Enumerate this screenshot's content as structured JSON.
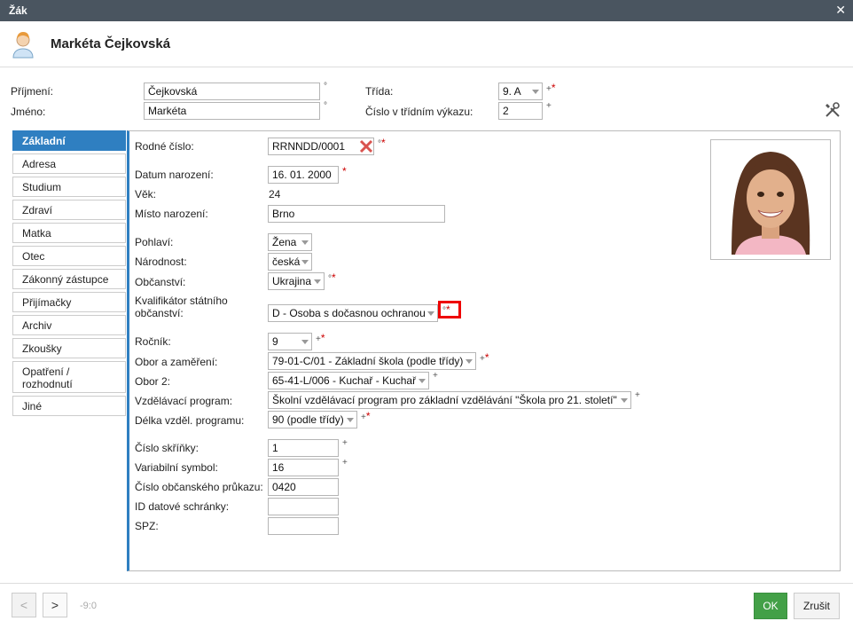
{
  "window": {
    "title": "Žák",
    "close_glyph": "✕"
  },
  "person": {
    "name": "Markéta Čejkovská",
    "avatar_icon": "user-avatar-icon"
  },
  "top": {
    "prijmeni_label": "Příjmení:",
    "prijmeni_value": "Čejkovská",
    "jmeno_label": "Jméno:",
    "jmeno_value": "Markéta",
    "trida_label": "Třída:",
    "trida_value": "9. A",
    "cislo_label": "Číslo v třídním výkazu:",
    "cislo_value": "2",
    "marks": {
      "degree": "°",
      "plus": "+",
      "req": "*"
    }
  },
  "tabs": [
    "Základní",
    "Adresa",
    "Studium",
    "Zdraví",
    "Matka",
    "Otec",
    "Zákonný zástupce",
    "Přijímačky",
    "Archiv",
    "Zkoušky",
    "Opatření / rozhodnutí",
    "Jiné"
  ],
  "active_tab": "Základní",
  "form": {
    "rodne_cislo_label": "Rodné číslo:",
    "rodne_cislo_value": "RRNNDD/0001",
    "datum_label": "Datum narození:",
    "datum_value": "16. 01. 2000",
    "vek_label": "Věk:",
    "vek_value": "24",
    "misto_label": "Místo narození:",
    "misto_value": "Brno",
    "pohlavi_label": "Pohlaví:",
    "pohlavi_value": "Žena",
    "narodnost_label": "Národnost:",
    "narodnost_value": "česká",
    "obcanstvi_label": "Občanství:",
    "obcanstvi_value": "Ukrajina",
    "kvalifikator_label_1": "Kvalifikátor státního",
    "kvalifikator_label_2": "občanství:",
    "kvalifikator_value": "D - Osoba s dočasnou ochranou",
    "rocnik_label": "Ročník:",
    "rocnik_value": "9",
    "obor_label": "Obor a zaměření:",
    "obor_value": "79-01-C/01 - Základní škola (podle třídy)",
    "obor2_label": "Obor 2:",
    "obor2_value": "65-41-L/006 - Kuchař - Kuchař",
    "program_label": "Vzdělávací program:",
    "program_value": "Školní vzdělávací program pro základní vzdělávání \"Škola pro 21. století\"",
    "delka_label": "Délka vzděl. programu:",
    "delka_value": "90 (podle třídy)",
    "skrinka_label": "Číslo skříňky:",
    "skrinka_value": "1",
    "vs_label": "Variabilní symbol:",
    "vs_value": "16",
    "op_label": "Číslo občanského průkazu:",
    "op_value": "0420",
    "ds_label": "ID datové schránky:",
    "ds_value": "",
    "spz_label": "SPZ:",
    "spz_value": ""
  },
  "footer": {
    "prev": "<",
    "next": ">",
    "counter": "-9:0",
    "ok": "OK",
    "cancel": "Zrušit"
  },
  "colors": {
    "titlebar": "#4a5560",
    "accent": "#2f7fc1",
    "ok": "#43a047",
    "required": "#cc0000",
    "highlight": "#ee0000"
  }
}
